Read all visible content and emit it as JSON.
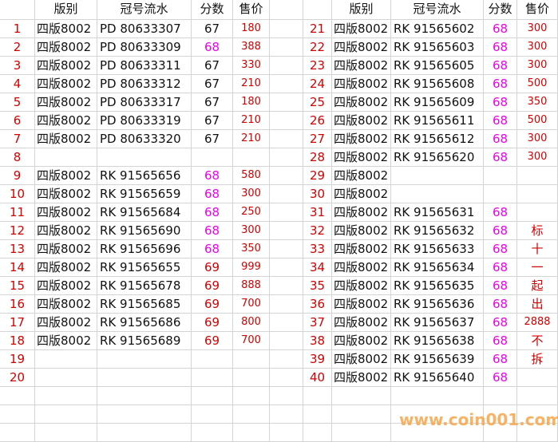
{
  "headers": {
    "index": "",
    "version": "版别",
    "serial": "冠号流水",
    "score": "分数",
    "price": "售价"
  },
  "left_rows": [
    {
      "n": "1",
      "version": "四版8002",
      "serial": "PD 80633307",
      "score": "67",
      "price": "180",
      "score_color": "black"
    },
    {
      "n": "2",
      "version": "四版8002",
      "serial": "PD 80633309",
      "score": "68",
      "price": "388",
      "score_color": "pink"
    },
    {
      "n": "3",
      "version": "四版8002",
      "serial": "PD 80633311",
      "score": "67",
      "price": "330",
      "score_color": "black"
    },
    {
      "n": "4",
      "version": "四版8002",
      "serial": "PD 80633312",
      "score": "67",
      "price": "210",
      "score_color": "black"
    },
    {
      "n": "5",
      "version": "四版8002",
      "serial": "PD 80633317",
      "score": "67",
      "price": "180",
      "score_color": "black"
    },
    {
      "n": "6",
      "version": "四版8002",
      "serial": "PD 80633319",
      "score": "67",
      "price": "210",
      "score_color": "black"
    },
    {
      "n": "7",
      "version": "四版8002",
      "serial": "PD 80633320",
      "score": "67",
      "price": "210",
      "score_color": "black"
    },
    {
      "n": "8",
      "version": "",
      "serial": "",
      "score": "",
      "price": "",
      "score_color": "black"
    },
    {
      "n": "9",
      "version": "四版8002",
      "serial": "RK 91565656",
      "score": "68",
      "price": "580",
      "score_color": "pink"
    },
    {
      "n": "10",
      "version": "四版8002",
      "serial": "RK 91565659",
      "score": "68",
      "price": "300",
      "score_color": "pink"
    },
    {
      "n": "11",
      "version": "四版8002",
      "serial": "RK 91565684",
      "score": "68",
      "price": "250",
      "score_color": "pink"
    },
    {
      "n": "12",
      "version": "四版8002",
      "serial": "RK 91565690",
      "score": "68",
      "price": "300",
      "score_color": "pink"
    },
    {
      "n": "13",
      "version": "四版8002",
      "serial": "RK 91565696",
      "score": "68",
      "price": "350",
      "score_color": "pink"
    },
    {
      "n": "14",
      "version": "四版8002",
      "serial": "RK 91565655",
      "score": "69",
      "price": "999",
      "score_color": "red"
    },
    {
      "n": "15",
      "version": "四版8002",
      "serial": "RK 91565678",
      "score": "69",
      "price": "888",
      "score_color": "red"
    },
    {
      "n": "16",
      "version": "四版8002",
      "serial": "RK 91565685",
      "score": "69",
      "price": "700",
      "score_color": "red"
    },
    {
      "n": "17",
      "version": "四版8002",
      "serial": "RK 91565686",
      "score": "69",
      "price": "800",
      "score_color": "red"
    },
    {
      "n": "18",
      "version": "四版8002",
      "serial": "RK 91565689",
      "score": "69",
      "price": "700",
      "score_color": "red"
    },
    {
      "n": "19",
      "version": "",
      "serial": "",
      "score": "",
      "price": "",
      "score_color": "black"
    },
    {
      "n": "20",
      "version": "",
      "serial": "",
      "score": "",
      "price": "",
      "score_color": "black"
    }
  ],
  "right_rows": [
    {
      "n": "21",
      "version": "四版8002",
      "serial": "RK 91565602",
      "score": "68",
      "price": "300",
      "score_color": "pink"
    },
    {
      "n": "22",
      "version": "四版8002",
      "serial": "RK 91565603",
      "score": "68",
      "price": "300",
      "score_color": "pink"
    },
    {
      "n": "23",
      "version": "四版8002",
      "serial": "RK 91565605",
      "score": "68",
      "price": "300",
      "score_color": "pink"
    },
    {
      "n": "24",
      "version": "四版8002",
      "serial": "RK 91565608",
      "score": "68",
      "price": "500",
      "score_color": "pink"
    },
    {
      "n": "25",
      "version": "四版8002",
      "serial": "RK 91565609",
      "score": "68",
      "price": "350",
      "score_color": "pink"
    },
    {
      "n": "26",
      "version": "四版8002",
      "serial": "RK 91565611",
      "score": "68",
      "price": "500",
      "score_color": "pink"
    },
    {
      "n": "27",
      "version": "四版8002",
      "serial": "RK 91565612",
      "score": "68",
      "price": "300",
      "score_color": "pink"
    },
    {
      "n": "28",
      "version": "四版8002",
      "serial": "RK 91565620",
      "score": "68",
      "price": "300",
      "score_color": "pink"
    },
    {
      "n": "29",
      "version": "四版8002",
      "serial": "",
      "score": "",
      "price": "",
      "score_color": "pink"
    },
    {
      "n": "30",
      "version": "四版8002",
      "serial": "",
      "score": "",
      "price": "",
      "score_color": "pink"
    },
    {
      "n": "31",
      "version": "四版8002",
      "serial": "RK 91565631",
      "score": "68",
      "price": "",
      "score_color": "pink"
    },
    {
      "n": "32",
      "version": "四版8002",
      "serial": "RK 91565632",
      "score": "68",
      "price": "标",
      "score_color": "pink"
    },
    {
      "n": "33",
      "version": "四版8002",
      "serial": "RK 91565633",
      "score": "68",
      "price": "十",
      "score_color": "pink"
    },
    {
      "n": "34",
      "version": "四版8002",
      "serial": "RK 91565634",
      "score": "68",
      "price": "一",
      "score_color": "pink"
    },
    {
      "n": "35",
      "version": "四版8002",
      "serial": "RK 91565635",
      "score": "68",
      "price": "起",
      "score_color": "pink"
    },
    {
      "n": "36",
      "version": "四版8002",
      "serial": "RK 91565636",
      "score": "68",
      "price": "出",
      "score_color": "pink"
    },
    {
      "n": "37",
      "version": "四版8002",
      "serial": "RK 91565637",
      "score": "68",
      "price": "2888",
      "score_color": "pink"
    },
    {
      "n": "38",
      "version": "四版8002",
      "serial": "RK 91565638",
      "score": "68",
      "price": "不",
      "score_color": "pink"
    },
    {
      "n": "39",
      "version": "四版8002",
      "serial": "RK 91565639",
      "score": "68",
      "price": "拆",
      "score_color": "pink"
    },
    {
      "n": "40",
      "version": "四版8002",
      "serial": "RK 91565640",
      "score": "68",
      "price": "",
      "score_color": "pink"
    }
  ],
  "watermark": "www.coin001.com",
  "colors": {
    "index": "#d40000",
    "price": "#d40000",
    "score_pink": "#ee00ee",
    "score_red": "#d40000",
    "score_black": "#111111",
    "grid": "#d4d4d4",
    "watermark": "#f7a54a"
  }
}
